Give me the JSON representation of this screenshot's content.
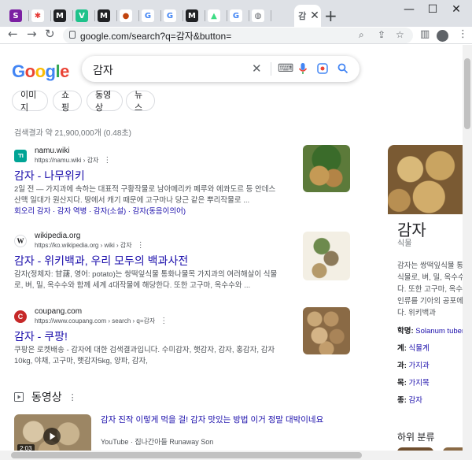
{
  "browser": {
    "tabs": [
      {
        "name": "tab-s",
        "glyph": "S",
        "color": "#7b1fa2",
        "fg": "#fff"
      },
      {
        "name": "tab-asterisk",
        "glyph": "✱",
        "color": "#fff",
        "fg": "#e53935"
      },
      {
        "name": "tab-m1",
        "glyph": "M",
        "color": "#202124",
        "fg": "#fff"
      },
      {
        "name": "tab-v",
        "glyph": "V",
        "color": "#1ec28b",
        "fg": "#fff"
      },
      {
        "name": "tab-m2",
        "glyph": "M",
        "color": "#202124",
        "fg": "#fff"
      },
      {
        "name": "tab-face",
        "glyph": "●",
        "color": "#fff",
        "fg": "#c1440e"
      },
      {
        "name": "tab-g1",
        "glyph": "G",
        "color": "#fff",
        "fg": "#4285f4"
      },
      {
        "name": "tab-g2",
        "glyph": "G",
        "color": "#fff",
        "fg": "#4285f4"
      },
      {
        "name": "tab-m3",
        "glyph": "M",
        "color": "#202124",
        "fg": "#fff"
      },
      {
        "name": "tab-android",
        "glyph": "▲",
        "color": "#fff",
        "fg": "#3ddc84"
      },
      {
        "name": "tab-g3",
        "glyph": "G",
        "color": "#fff",
        "fg": "#4285f4"
      },
      {
        "name": "tab-globe",
        "glyph": "◍",
        "color": "#fff",
        "fg": "#5f6368"
      }
    ],
    "active_tab_glyph": "감",
    "close_glyph": "✕",
    "newtab_glyph": "+",
    "minimize_glyph": "—",
    "maximize_glyph": "☐",
    "winclose_glyph": "✕",
    "back_glyph": "←",
    "forward_glyph": "→",
    "reload_glyph": "↻",
    "url": "google.com/search?q=감자&button="
  },
  "search": {
    "logo": "Google",
    "query": "감자",
    "clear_glyph": "✕",
    "chips": [
      "이미지",
      "쇼핑",
      "동영상",
      "뉴스"
    ],
    "stats": "검색결과 약 21,900,000개 (0.48초)"
  },
  "results": [
    {
      "site": "namu.wiki",
      "url": "https://namu.wiki › 감자",
      "title": "감자 - 나무위키",
      "snippet1": "2일 전 — 가지과에 속하는 대표적 구황작물로 남아메리카 페루와 에콰도르 등 안데스",
      "snippet2": "산맥 일대가 원산지다. 땅에서 캐기 때문에 고구마나 당근 같은 뿌리작물로 ...",
      "links": "회오리 감자 · 감자 역병 · 감자(소설) · 감자(동음이의어)",
      "fav": "ㄲ",
      "favbg": "#00a495",
      "favfg": "#fff"
    },
    {
      "site": "wikipedia.org",
      "url": "https://ko.wikipedia.org › wiki › 감자",
      "title": "감자 - 위키백과, 우리 모두의 백과사전",
      "snippet1": "감자(정체자: 甘藷, 영어: potato)는 쌍떡잎식물 통화나물목 가지과의 여러해살이 식물",
      "snippet2": "로, 벼, 밀, 옥수수와 함께 세계 4대작물에 해당한다. 또한 고구마, 옥수수와 ...",
      "links": "",
      "fav": "W",
      "favbg": "#fff",
      "favfg": "#202124"
    },
    {
      "site": "coupang.com",
      "url": "https://www.coupang.com › search › q=감자",
      "title": "감자 - 쿠팡!",
      "snippet1": "쿠팡은 로켓배송 - 감자에 대한 검색결과입니다. 수미감자, 햇감자, 감자, 홍감자, 감자",
      "snippet2": "10kg, 야채, 고구마, 햇감자5kg, 양파, 감자,",
      "links": "",
      "fav": "C",
      "favbg": "#c62828",
      "favfg": "#fff"
    }
  ],
  "videos": {
    "heading": "동영상",
    "title": "감자 진작 이렇게 먹을 걸! 감자 맛있는 방법 이거 정말 대박이네요",
    "source": "YouTube",
    "channel": "집나간아들 Runaway Son",
    "duration": "2:03"
  },
  "knowledge": {
    "title": "감자",
    "subtitle": "식물",
    "desc": [
      "감자는 쌍떡잎식물 통화",
      "식물로, 벼, 밀, 옥수수",
      "다. 또한 고구마, 옥수수",
      "인류를 기아의 공포에",
      "다. 위키백과"
    ],
    "facts": [
      {
        "label": "학명:",
        "value": "Solanum tuberosum"
      },
      {
        "label": "계:",
        "value": "식물계"
      },
      {
        "label": "과:",
        "value": "가지과"
      },
      {
        "label": "목:",
        "value": "가지목"
      },
      {
        "label": "종:",
        "value": "감자"
      }
    ],
    "section": "하위 분류"
  }
}
